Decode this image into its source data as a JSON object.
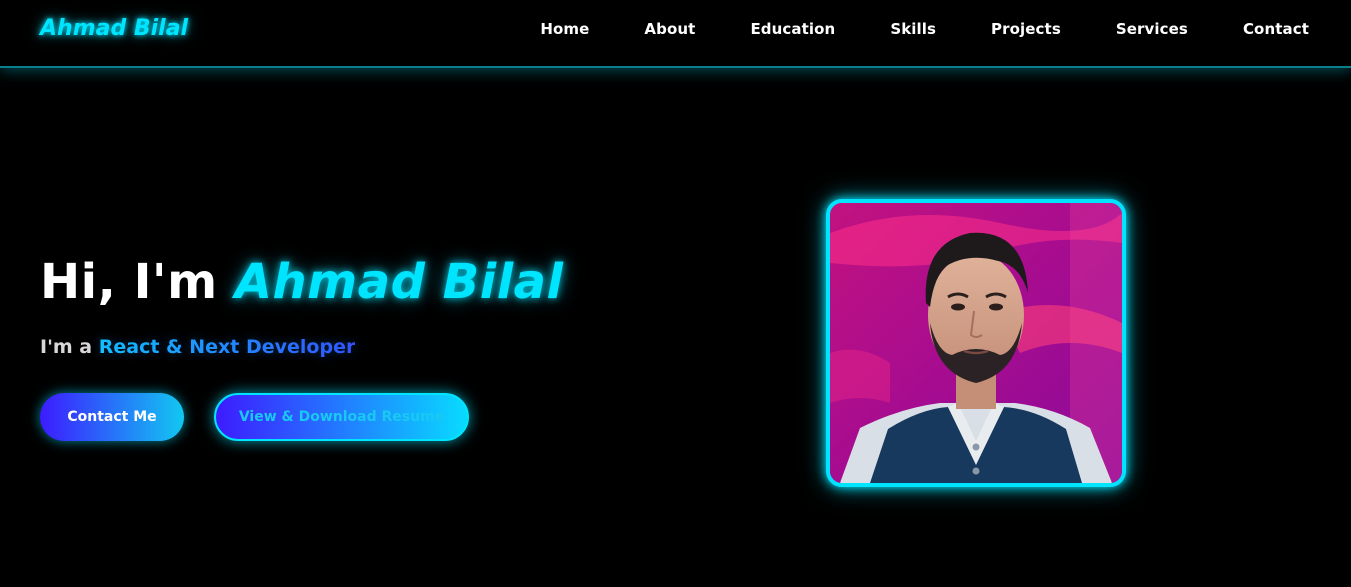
{
  "header": {
    "brand": "Ahmad Bilal",
    "nav": [
      {
        "label": "Home"
      },
      {
        "label": "About"
      },
      {
        "label": "Education"
      },
      {
        "label": "Skills"
      },
      {
        "label": "Projects"
      },
      {
        "label": "Services"
      },
      {
        "label": "Contact"
      }
    ]
  },
  "hero": {
    "greeting": "Hi, I'm ",
    "name": "Ahmad Bilal",
    "subtitle_prefix": "I'm a ",
    "role": "React & Next Developer",
    "contact_button": "Contact Me",
    "resume_button": "View & Download Resume"
  },
  "colors": {
    "accent": "#00e5ff",
    "gradient_start": "#3d1bff",
    "background": "#000000"
  },
  "icons": {
    "profile_photo": "profile-photo"
  }
}
